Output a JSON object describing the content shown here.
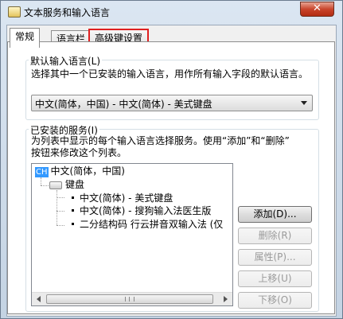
{
  "window": {
    "title": "文本服务和输入语言",
    "close_glyph": "✕"
  },
  "tabs": [
    {
      "label": "常规",
      "active": true
    },
    {
      "label": "语言栏",
      "active": false
    },
    {
      "label": "高级键设置",
      "active": false,
      "highlighted": true
    }
  ],
  "default_language": {
    "group_title": "默认输入语言(L)",
    "description": "选择其中一个已安装的输入语言，用作所有输入字段的默认语言。",
    "selected": "中文(简体，中国) - 中文(简体) - 美式键盘"
  },
  "installed_services": {
    "group_title": "已安装的服务(I)",
    "description_line1": "为列表中显示的每个输入语言选择服务。使用“添加”和“删除”",
    "description_line2": "按钮来修改这个列表。",
    "tree": {
      "language_badge": "CH",
      "language": "中文(简体，中国)",
      "category": "键盘",
      "items": [
        "中文(简体) - 美式键盘",
        "中文(简体) - 搜狗输入法医生版",
        "二分结构码 行云拼音双输入法 (仅"
      ]
    }
  },
  "buttons": {
    "add": "添加(D)...",
    "remove": "删除(R)",
    "properties": "属性(P)...",
    "move_up": "上移(U)",
    "move_down": "下移(O)"
  },
  "colors": {
    "highlight_border": "#e02020",
    "badge_bg": "#3399ff"
  }
}
